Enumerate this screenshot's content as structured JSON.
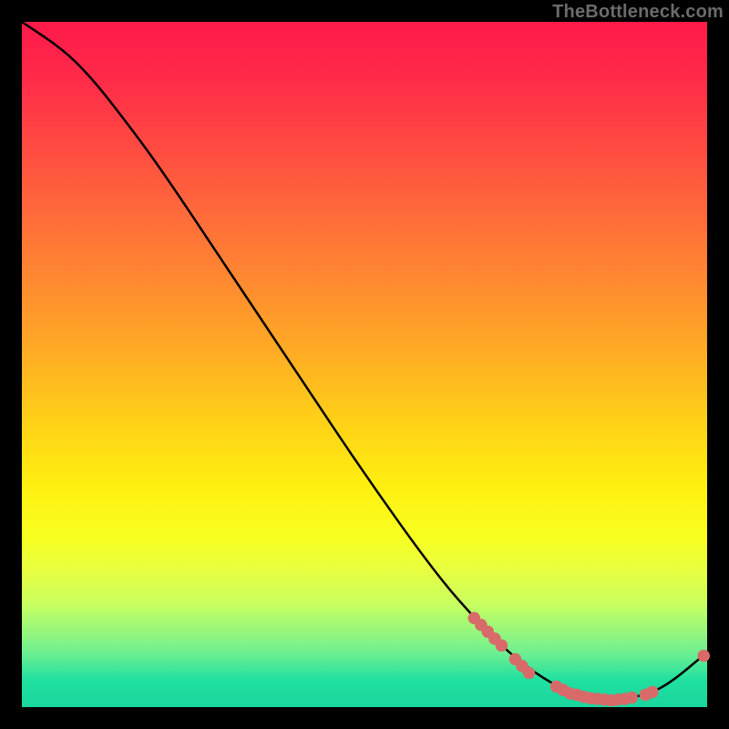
{
  "watermark": {
    "text": "TheBottleneck.com"
  },
  "chart_data": {
    "type": "line",
    "title": "",
    "xlabel": "",
    "ylabel": "",
    "xlim": [
      0,
      100
    ],
    "ylim": [
      0,
      100
    ],
    "grid": false,
    "curve": {
      "name": "bottleneck-curve",
      "color": "#000000",
      "points": [
        {
          "x": 0,
          "y": 100
        },
        {
          "x": 6,
          "y": 96
        },
        {
          "x": 10,
          "y": 92
        },
        {
          "x": 14,
          "y": 87
        },
        {
          "x": 20,
          "y": 79
        },
        {
          "x": 30,
          "y": 64
        },
        {
          "x": 40,
          "y": 49
        },
        {
          "x": 50,
          "y": 34
        },
        {
          "x": 60,
          "y": 20
        },
        {
          "x": 66,
          "y": 13
        },
        {
          "x": 72,
          "y": 7
        },
        {
          "x": 78,
          "y": 3
        },
        {
          "x": 82,
          "y": 1.5
        },
        {
          "x": 86,
          "y": 1
        },
        {
          "x": 90,
          "y": 1.5
        },
        {
          "x": 94,
          "y": 3
        },
        {
          "x": 100,
          "y": 8
        }
      ]
    },
    "markers": {
      "name": "segment-markers",
      "color": "#d86a6a",
      "radius_pct": 0.9,
      "points": [
        {
          "x": 66,
          "y": 13
        },
        {
          "x": 67,
          "y": 12
        },
        {
          "x": 68,
          "y": 11
        },
        {
          "x": 69,
          "y": 10
        },
        {
          "x": 70,
          "y": 9
        },
        {
          "x": 72,
          "y": 7
        },
        {
          "x": 73,
          "y": 6
        },
        {
          "x": 74,
          "y": 5
        },
        {
          "x": 78,
          "y": 3
        },
        {
          "x": 79,
          "y": 2.5
        },
        {
          "x": 80,
          "y": 2
        },
        {
          "x": 81,
          "y": 1.8
        },
        {
          "x": 82,
          "y": 1.5
        },
        {
          "x": 83,
          "y": 1.3
        },
        {
          "x": 84,
          "y": 1.2
        },
        {
          "x": 85,
          "y": 1.1
        },
        {
          "x": 86,
          "y": 1
        },
        {
          "x": 87,
          "y": 1.1
        },
        {
          "x": 88,
          "y": 1.2
        },
        {
          "x": 89,
          "y": 1.4
        },
        {
          "x": 91,
          "y": 1.8
        },
        {
          "x": 92,
          "y": 2.2
        },
        {
          "x": 99.5,
          "y": 7.5
        }
      ]
    }
  }
}
